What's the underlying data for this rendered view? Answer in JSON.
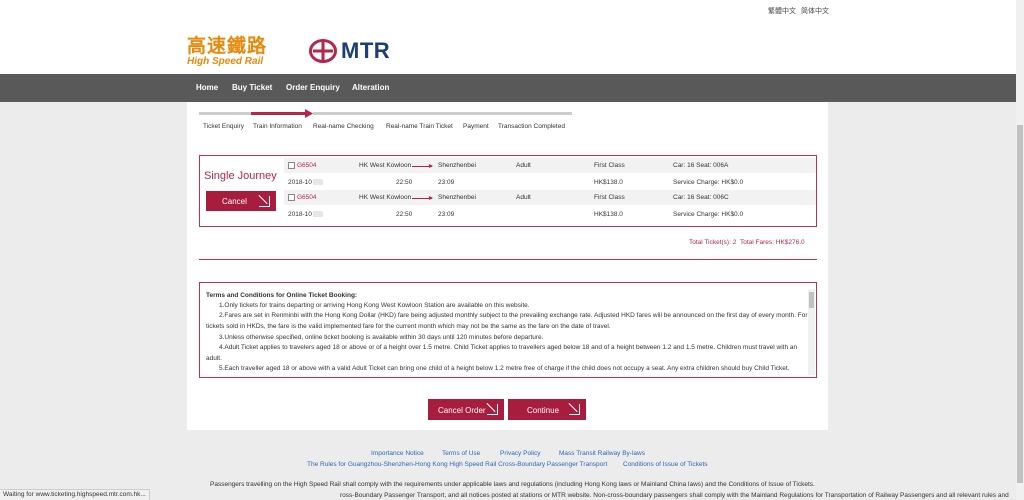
{
  "languages": [
    "繁體中文",
    "简体中文"
  ],
  "logo": {
    "chinese": "高速鐵路",
    "english": "High Speed Rail",
    "mtr": "MTR"
  },
  "nav": [
    "Home",
    "Buy Ticket",
    "Order Enquiry",
    "Alteration"
  ],
  "steps": [
    "Ticket Enquiry",
    "Train Information",
    "Real-name Checking",
    "Real-name Train Ticket",
    "Payment",
    "Transaction Completed"
  ],
  "current_step": 1,
  "journey": {
    "title": "Single Journey",
    "cancel_label": "Cancel",
    "trips": [
      {
        "train": "G6504",
        "from": "HK West Kowloon",
        "to": "Shenzhenbei",
        "type": "Adult",
        "class": "First Class",
        "car_seat": "Car: 16   Seat: 006A",
        "date": "2018-10",
        "depart": "22:50",
        "arrive": "23:09",
        "fare": "HK$138.0",
        "service": "Service Charge: HK$0.0"
      },
      {
        "train": "G6504",
        "from": "HK West Kowloon",
        "to": "Shenzhenbei",
        "type": "Adult",
        "class": "First Class",
        "car_seat": "Car: 16   Seat: 006C",
        "date": "2018-10",
        "depart": "22:50",
        "arrive": "23:09",
        "fare": "HK$138.0",
        "service": "Service Charge: HK$0.0"
      }
    ],
    "total_tickets": "Total Ticket(s): 2",
    "total_fares": "Total Fares: HK$276.0"
  },
  "terms": {
    "title": "Terms and Conditions for Online Ticket Booking:",
    "lines": [
      "1.Only tickets for trains departing or arriving Hong Kong West Kowloon Station are available on this website.",
      "2.Fares are set in Renminbi with the Hong Kong Dollar (HKD) fare being adjusted monthly subject to the prevailing exchange rate. Adjusted HKD fares will be announced on the first day of every month. For",
      "tickets sold in HKDs, the fare is the valid implemented fare for the current month which may not be the same as the fare on the date of travel.",
      "3.Unless otherwise specified, online ticket booking is available within 30 days until 120 minutes before departure.",
      "4.Adult Ticket applies to travelers aged 18 or above or of a height over 1.5 metre. Child Ticket applies to travellers aged below 18 and of a height between 1.2 and 1.5 metre. Children must travel with an",
      "adult.",
      "5.Each traveller aged 18 or above with a valid Adult Ticket can bring one child of a height below 1.2 metre free of charge if the child does not occupy a seat. Any extra children should buy Child Ticket."
    ]
  },
  "actions": {
    "cancel_order": "Cancel Order",
    "continue": "Continue"
  },
  "footer": {
    "links_row1": [
      "Importance Notice",
      "Terms of Use",
      "Privacy Policy",
      "Mass Transit Railway By-laws"
    ],
    "links_row2": [
      "The Rules for Guangzhou-Shenzhen-Hong Kong High Speed Rail Cross-Boundary Passenger Transport",
      "Conditions of Issue of Tickets"
    ],
    "text1": "Passengers travelling on the High Speed Rail shall comply with the requirements under applicable laws and regulations (including Hong Kong laws or Mainland China laws) and the Conditions of Issue of Tickets.",
    "text2": "ross-Boundary Passenger Transport, and all notices posted at stations or MTR website. Non-cross-boundary passengers shall comply with the Mainland Regulations for Transportation of Railway Passengers and all relevant rules and"
  },
  "status_bar": "Waiting for www.ticketing.highspeed.mtr.com.hk...",
  "colors": {
    "accent": "#a81c3e",
    "nav_bg": "#595959",
    "hsr_orange": "#e8890c",
    "mtr_blue": "#1c3f7a"
  }
}
